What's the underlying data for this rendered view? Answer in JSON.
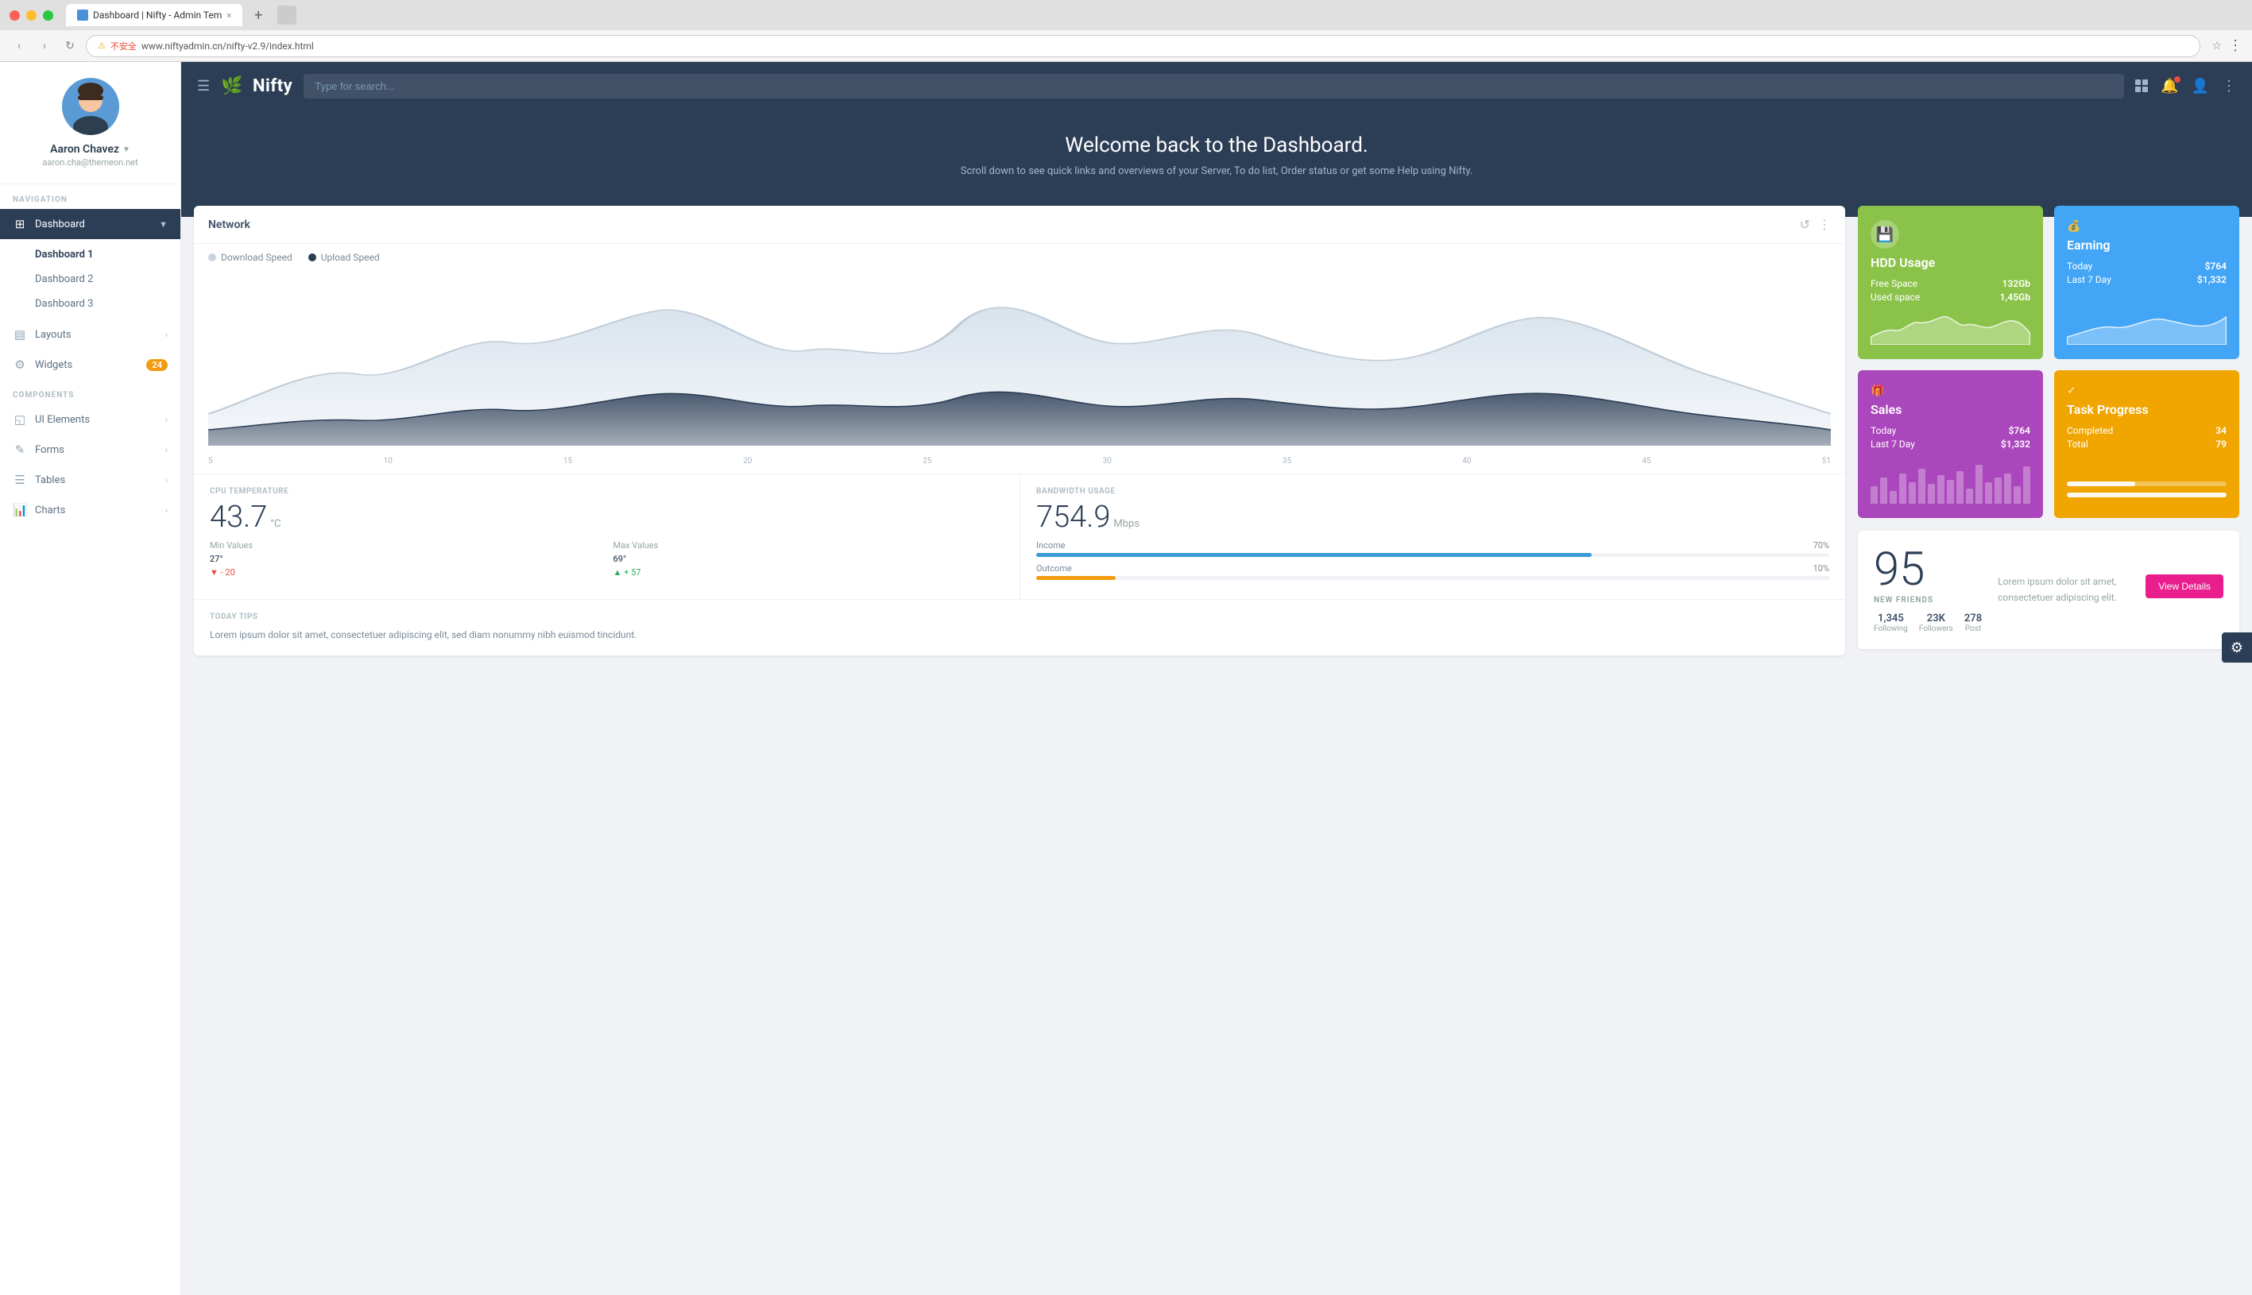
{
  "browser": {
    "tab_title": "Dashboard | Nifty - Admin Tem",
    "tab_close": "×",
    "url": "www.niftyadmin.cn/nifty-v2.9/index.html",
    "url_prefix": "不安全",
    "new_tab_label": "+"
  },
  "header": {
    "logo_text": "Nifty",
    "search_placeholder": "Type for search...",
    "icons": [
      "grid",
      "bell",
      "user",
      "menu"
    ]
  },
  "sidebar": {
    "user": {
      "name": "Aaron Chavez",
      "email": "aaron.cha@themeon.net"
    },
    "nav_label": "NAVIGATION",
    "nav_items": [
      {
        "label": "Dashboard",
        "icon": "⊞",
        "active": true,
        "has_arrow": true
      },
      {
        "label": "Layouts",
        "icon": "▤",
        "has_arrow": true
      },
      {
        "label": "Widgets",
        "icon": "⚙",
        "badge": "24"
      }
    ],
    "dashboard_sub": [
      {
        "label": "Dashboard 1",
        "active": true
      },
      {
        "label": "Dashboard 2"
      },
      {
        "label": "Dashboard 3"
      }
    ],
    "components_label": "COMPONENTS",
    "components_items": [
      {
        "label": "UI Elements",
        "has_arrow": true
      },
      {
        "label": "Forms",
        "has_arrow": true
      },
      {
        "label": "Tables",
        "has_arrow": true
      },
      {
        "label": "Charts",
        "has_arrow": true
      }
    ]
  },
  "main": {
    "welcome_title": "Welcome back to the Dashboard.",
    "welcome_subtitle": "Scroll down to see quick links and overviews of your Server, To do list, Order status or get some Help using Nifty.",
    "network_card": {
      "title": "Network",
      "legend_download": "Download Speed",
      "legend_upload": "Upload Speed",
      "chart_labels": [
        "5",
        "10",
        "15",
        "20",
        "25",
        "30",
        "35",
        "40",
        "45",
        "51"
      ]
    },
    "cpu": {
      "label": "CPU TEMPERATURE",
      "value": "43.7",
      "unit": "°C",
      "min_label": "Min Values",
      "min_val": "27°",
      "min_change": "▼ - 20",
      "max_label": "Max Values",
      "max_val": "69°",
      "max_change": "▲ + 57"
    },
    "bandwidth": {
      "label": "BANDWIDTH USAGE",
      "value": "754.9",
      "unit": "Mbps",
      "income_label": "Income",
      "income_pct": "70%",
      "income_width": 70,
      "outcome_label": "Outcome",
      "outcome_pct": "10%",
      "outcome_width": 10
    },
    "today_tips": {
      "label": "TODAY TIPS",
      "text": "Lorem ipsum dolor sit amet, consectetuer adipiscing elit, sed diam nonummy nibh euismod tincidunt."
    }
  },
  "widgets": {
    "hdd": {
      "title": "HDD Usage",
      "icon": "💾",
      "free_label": "Free Space",
      "free_val": "132Gb",
      "used_label": "Used space",
      "used_val": "1,45Gb"
    },
    "earning": {
      "title": "Earning",
      "today_label": "Today",
      "today_val": "$764",
      "week_label": "Last 7 Day",
      "week_val": "$1,332"
    },
    "sales": {
      "title": "Sales",
      "today_label": "Today",
      "today_val": "$764",
      "week_label": "Last 7 Day",
      "week_val": "$1,332",
      "bars": [
        40,
        60,
        30,
        70,
        50,
        80,
        45,
        65,
        55,
        75,
        35,
        90,
        50,
        60,
        70,
        40,
        85
      ]
    },
    "task": {
      "title": "Task Progress",
      "completed_label": "Completed",
      "completed_val": "34",
      "total_label": "Total",
      "total_val": "79",
      "completed_pct": 43,
      "total_pct": 100
    }
  },
  "social": {
    "number": "95",
    "label": "NEW FRIENDS",
    "desc": "Lorem ipsum dolor sit amet, consectetuer adipiscing elit.",
    "btn_label": "View Details",
    "stats": [
      {
        "val": "1,345",
        "label": "Following"
      },
      {
        "val": "23K",
        "label": "Followers"
      },
      {
        "val": "278",
        "label": "Post"
      }
    ]
  }
}
